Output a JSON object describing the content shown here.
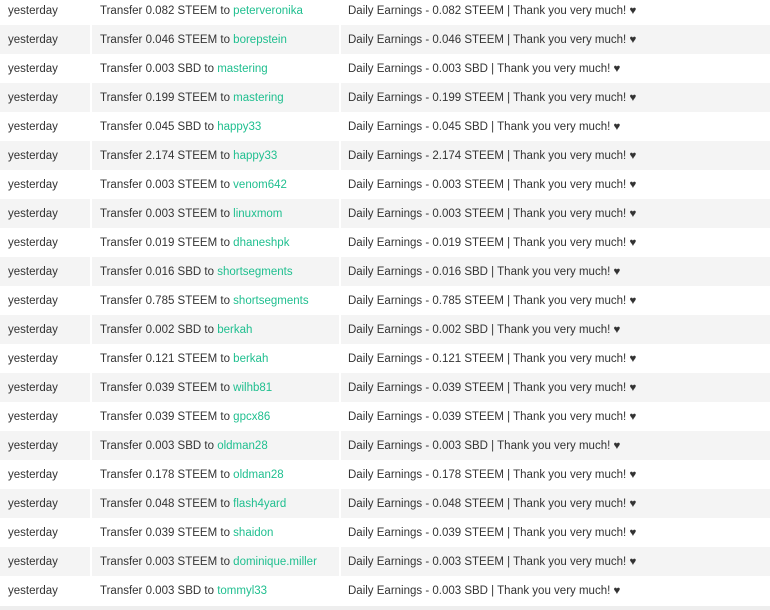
{
  "accent_color": "#1fbf8f",
  "transactions": [
    {
      "date": "yesterday",
      "prefix": "Transfer 0.082 STEEM to",
      "recipient": "peterveronika",
      "memo": "Daily Earnings - 0.082 STEEM | Thank you very much! ♥"
    },
    {
      "date": "yesterday",
      "prefix": "Transfer 0.046 STEEM to",
      "recipient": "borepstein",
      "memo": "Daily Earnings - 0.046 STEEM | Thank you very much! ♥"
    },
    {
      "date": "yesterday",
      "prefix": "Transfer 0.003 SBD to",
      "recipient": "mastering",
      "memo": "Daily Earnings - 0.003 SBD | Thank you very much! ♥"
    },
    {
      "date": "yesterday",
      "prefix": "Transfer 0.199 STEEM to",
      "recipient": "mastering",
      "memo": "Daily Earnings - 0.199 STEEM | Thank you very much! ♥"
    },
    {
      "date": "yesterday",
      "prefix": "Transfer 0.045 SBD to",
      "recipient": "happy33",
      "memo": "Daily Earnings - 0.045 SBD | Thank you very much! ♥"
    },
    {
      "date": "yesterday",
      "prefix": "Transfer 2.174 STEEM to",
      "recipient": "happy33",
      "memo": "Daily Earnings - 2.174 STEEM | Thank you very much! ♥"
    },
    {
      "date": "yesterday",
      "prefix": "Transfer 0.003 STEEM to",
      "recipient": "venom642",
      "memo": "Daily Earnings - 0.003 STEEM | Thank you very much! ♥"
    },
    {
      "date": "yesterday",
      "prefix": "Transfer 0.003 STEEM to",
      "recipient": "linuxmom",
      "memo": "Daily Earnings - 0.003 STEEM | Thank you very much! ♥"
    },
    {
      "date": "yesterday",
      "prefix": "Transfer 0.019 STEEM to",
      "recipient": "dhaneshpk",
      "memo": "Daily Earnings - 0.019 STEEM | Thank you very much! ♥"
    },
    {
      "date": "yesterday",
      "prefix": "Transfer 0.016 SBD to",
      "recipient": "shortsegments",
      "memo": "Daily Earnings - 0.016 SBD | Thank you very much! ♥"
    },
    {
      "date": "yesterday",
      "prefix": "Transfer 0.785 STEEM to",
      "recipient": "shortsegments",
      "memo": "Daily Earnings - 0.785 STEEM | Thank you very much! ♥"
    },
    {
      "date": "yesterday",
      "prefix": "Transfer 0.002 SBD to",
      "recipient": "berkah",
      "memo": "Daily Earnings - 0.002 SBD | Thank you very much! ♥"
    },
    {
      "date": "yesterday",
      "prefix": "Transfer 0.121 STEEM to",
      "recipient": "berkah",
      "memo": "Daily Earnings - 0.121 STEEM | Thank you very much! ♥"
    },
    {
      "date": "yesterday",
      "prefix": "Transfer 0.039 STEEM to",
      "recipient": "wilhb81",
      "memo": "Daily Earnings - 0.039 STEEM | Thank you very much! ♥"
    },
    {
      "date": "yesterday",
      "prefix": "Transfer 0.039 STEEM to",
      "recipient": "gpcx86",
      "memo": "Daily Earnings - 0.039 STEEM | Thank you very much! ♥"
    },
    {
      "date": "yesterday",
      "prefix": "Transfer 0.003 SBD to",
      "recipient": "oldman28",
      "memo": "Daily Earnings - 0.003 SBD | Thank you very much! ♥"
    },
    {
      "date": "yesterday",
      "prefix": "Transfer 0.178 STEEM to",
      "recipient": "oldman28",
      "memo": "Daily Earnings - 0.178 STEEM | Thank you very much! ♥"
    },
    {
      "date": "yesterday",
      "prefix": "Transfer 0.048 STEEM to",
      "recipient": "flash4yard",
      "memo": "Daily Earnings - 0.048 STEEM | Thank you very much! ♥"
    },
    {
      "date": "yesterday",
      "prefix": "Transfer 0.039 STEEM to",
      "recipient": "shaidon",
      "memo": "Daily Earnings - 0.039 STEEM | Thank you very much! ♥"
    },
    {
      "date": "yesterday",
      "prefix": "Transfer 0.003 STEEM to",
      "recipient": "dominique.miller",
      "memo": "Daily Earnings - 0.003 STEEM | Thank you very much! ♥"
    },
    {
      "date": "yesterday",
      "prefix": "Transfer 0.003 SBD to",
      "recipient": "tommyl33",
      "memo": "Daily Earnings - 0.003 SBD | Thank you very much! ♥"
    }
  ]
}
